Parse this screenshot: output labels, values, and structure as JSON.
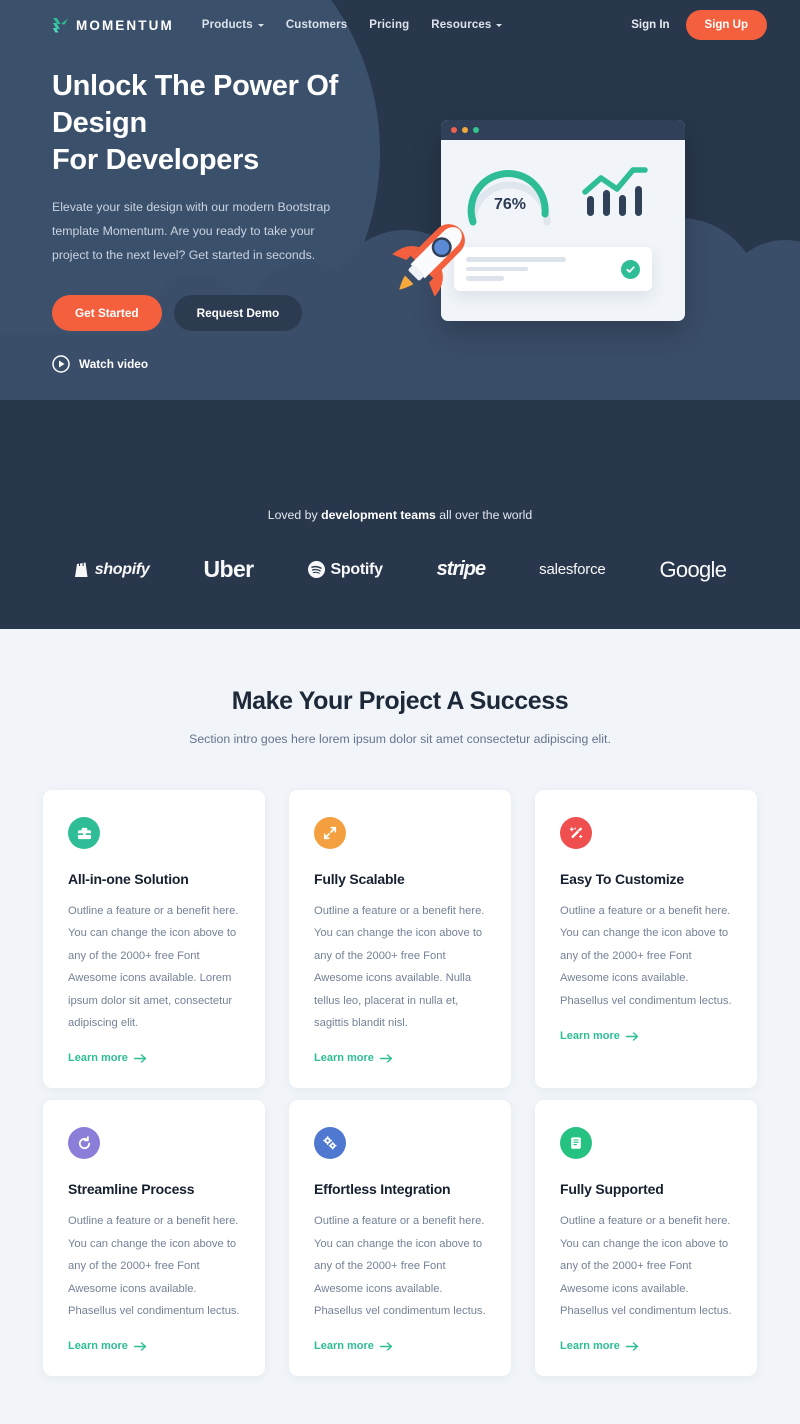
{
  "brand": {
    "name": "MOMENTUM",
    "mark_icon": "momentum-logo-icon"
  },
  "nav": {
    "links": [
      {
        "label": "Products",
        "has_dropdown": true
      },
      {
        "label": "Customers",
        "has_dropdown": false
      },
      {
        "label": "Pricing",
        "has_dropdown": false
      },
      {
        "label": "Resources",
        "has_dropdown": true
      }
    ],
    "sign_in": "Sign In",
    "sign_up": "Sign Up"
  },
  "hero": {
    "title": "Unlock The Power Of Design For Developers",
    "title_line1": "Unlock The Power Of Design",
    "title_line2": "For Developers",
    "subtitle": "Elevate your site design with our modern Bootstrap template Momentum. Are you ready to take your project to the next level? Get started in seconds.",
    "primary_button": "Get Started",
    "secondary_button": "Request Demo",
    "watch_video": "Watch video",
    "dashboard": {
      "gauge_value": "76%",
      "gauge_percent": 76,
      "window_dots": [
        "red",
        "yellow",
        "green"
      ],
      "bars": [
        36,
        52,
        40,
        60
      ],
      "check_icon": "check-icon"
    }
  },
  "social_proof": {
    "prefix": "Loved by ",
    "emphasis": "development teams",
    "suffix": " all over the world",
    "logos": [
      {
        "name": "shopify",
        "label": "shopify"
      },
      {
        "name": "uber",
        "label": "Uber"
      },
      {
        "name": "spotify",
        "label": "Spotify"
      },
      {
        "name": "stripe",
        "label": "stripe"
      },
      {
        "name": "salesforce",
        "label": "salesforce"
      },
      {
        "name": "google",
        "label": "Google"
      }
    ]
  },
  "features": {
    "title": "Make Your Project A Success",
    "subtitle": "Section intro goes here lorem ipsum dolor sit amet consectetur adipiscing elit.",
    "link_label": "Learn more",
    "cards": [
      {
        "title": "All-in-one Solution",
        "text": "Outline a feature or a benefit here. You can change the icon above to any of the 2000+ free Font Awesome icons available. Lorem ipsum dolor sit amet, consectetur adipiscing elit.",
        "link": "Learn more",
        "icon": "briefcase-icon",
        "color": "#2ebd96"
      },
      {
        "title": "Fully Scalable",
        "text": "Outline a feature or a benefit here. You can change the icon above to any of the 2000+ free Font Awesome icons available. Nulla tellus leo, placerat in nulla et, sagittis blandit nisl.",
        "link": "Learn more",
        "icon": "expand-arrows-icon",
        "color": "#f5a040"
      },
      {
        "title": "Easy To Customize",
        "text": "Outline a feature or a benefit here. You can change the icon above to any of the 2000+ free Font Awesome icons available. Phasellus vel condimentum lectus.",
        "link": "Learn more",
        "icon": "magic-wand-icon",
        "color": "#ef4f4f"
      },
      {
        "title": "Streamline Process",
        "text": "Outline a feature or a benefit here. You can change the icon above to any of the 2000+ free Font Awesome icons available. Phasellus vel condimentum lectus.",
        "link": "Learn more",
        "icon": "refresh-icon",
        "color": "#8b7ed8"
      },
      {
        "title": "Effortless Integration",
        "text": "Outline a feature or a benefit here. You can change the icon above to any of the 2000+ free Font Awesome icons available. Phasellus vel condimentum lectus.",
        "link": "Learn more",
        "icon": "cogs-icon",
        "color": "#4f79d0"
      },
      {
        "title": "Fully Supported",
        "text": "Outline a feature or a benefit here. You can change the icon above to any of the 2000+ free Font Awesome icons available. Phasellus vel condimentum lectus.",
        "link": "Learn more",
        "icon": "book-icon",
        "color": "#26c281"
      }
    ]
  },
  "colors": {
    "hero_bg": "#28374b",
    "hero_circle": "#3b506b",
    "accent_orange": "#f4603e",
    "accent_teal": "#2ebd96",
    "section_bg": "#f1f5f9",
    "heading": "#1d2939"
  }
}
